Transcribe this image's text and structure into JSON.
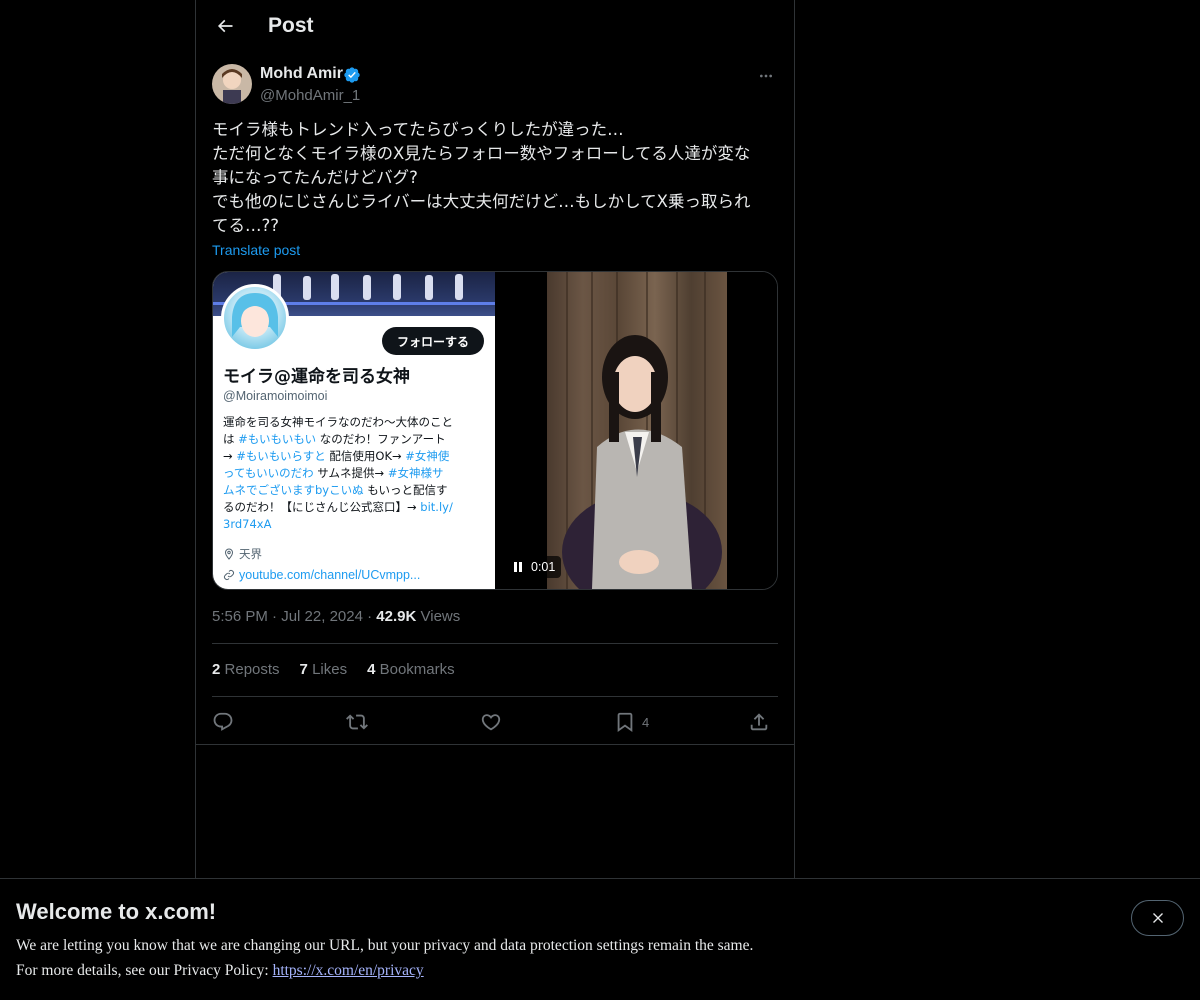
{
  "header": {
    "title": "Post"
  },
  "author": {
    "name": "Mohd Amir",
    "handle": "@MohdAmir_1"
  },
  "post": {
    "lines": [
      "モイラ様もトレンド入ってたらびっくりしたが違った…",
      "ただ何となくモイラ様のX見たらフォロー数やフォローしてる人達が変な",
      "事になってたんだけどバグ?",
      "でも他のにじさんじライバーは大丈夫何だけど…もしかしてX乗っ取られ",
      "てる…??"
    ],
    "translate_label": "Translate post"
  },
  "media": {
    "card": {
      "follow_label": "フォローする",
      "name": "モイラ@運命を司る女神",
      "handle": "@Moiramoimoimoi",
      "bio_parts": [
        [
          "運命を司る女神モイラなのだわ〜大体のこと"
        ],
        [
          "は ",
          "#もいもいもい",
          " なのだわ！ファンアート"
        ],
        [
          "→ ",
          "#もいもいらすと",
          " 配信使用OK→ ",
          "#女神使"
        ],
        [
          "ってもいいのだわ",
          " サムネ提供→ ",
          "#女神様サ"
        ],
        [
          "ムネでございますbyこいぬ",
          " もいっと配信す"
        ],
        [
          "るのだわ！【にじさんじ公式窓口】→ ",
          "bit.ly/"
        ],
        [
          "3rd74xA"
        ]
      ],
      "location": "天界",
      "link": "youtube.com/channel/UCvmpp..."
    },
    "video": {
      "time": "0:01"
    }
  },
  "meta": {
    "time": "5:56 PM",
    "sep": "·",
    "date": "Jul 22, 2024",
    "views_count": "42.9K",
    "views_label": "Views"
  },
  "stats": {
    "reposts_count": "2",
    "reposts_label": "Reposts",
    "likes_count": "7",
    "likes_label": "Likes",
    "bookmarks_count": "4",
    "bookmarks_label": "Bookmarks"
  },
  "actions": {
    "bookmark_count": "4"
  },
  "banner": {
    "title": "Welcome to x.com!",
    "line1": "We are letting you know that we are changing our URL, but your privacy and data protection settings remain the same.",
    "line2_prefix": "For more details, see our Privacy Policy: ",
    "link": "https://x.com/en/privacy"
  },
  "colors": {
    "accent": "#1d9bf0",
    "background": "#000000",
    "text": "#e7e9ea",
    "muted": "#71767b",
    "border": "#2f3336"
  }
}
